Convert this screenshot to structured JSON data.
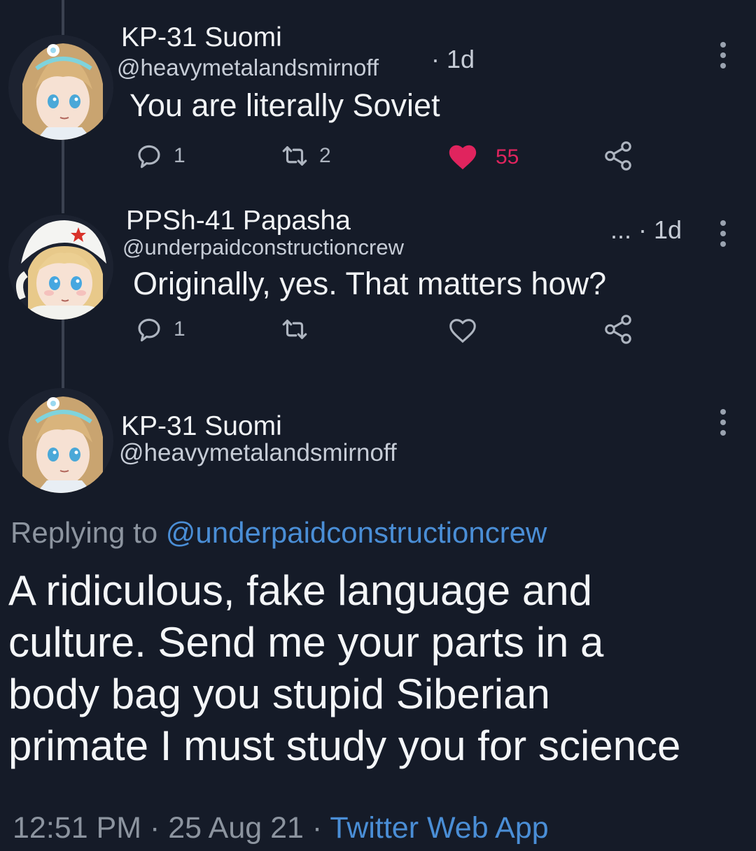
{
  "tweets": [
    {
      "name": "KP-31 Suomi",
      "handle": "@heavymetalandsmirnoff",
      "time": "· 1d",
      "text": "You are literally Soviet",
      "actions": {
        "replies": "1",
        "retweets": "2",
        "likes": "55",
        "liked": true
      }
    },
    {
      "name": "PPSh-41 Papasha",
      "handle": "@underpaidconstructioncrew",
      "time": "... · 1d",
      "text": "Originally, yes. That matters how?",
      "actions": {
        "replies": "1",
        "retweets": "",
        "likes": "",
        "liked": false
      }
    }
  ],
  "main_tweet": {
    "name": "KP-31 Suomi",
    "handle": "@heavymetalandsmirnoff",
    "replying_prefix": "Replying to",
    "replying_to": "@underpaidconstructioncrew",
    "text_lines": [
      "A ridiculous, fake language and",
      "culture. Send me your parts in a",
      "body bag you stupid Siberian",
      "primate I must study you for science"
    ],
    "timestamp": "12:51 PM · 25 Aug 21 · ",
    "source": "Twitter Web App"
  },
  "icons": {
    "reply": "reply-icon",
    "retweet": "retweet-icon",
    "like": "heart-icon",
    "share": "share-icon",
    "more": "more-vertical-icon"
  },
  "colors": {
    "background": "#151b28",
    "like_active": "#e0245e",
    "link": "#4a8ed6",
    "muted": "#8c949f"
  }
}
